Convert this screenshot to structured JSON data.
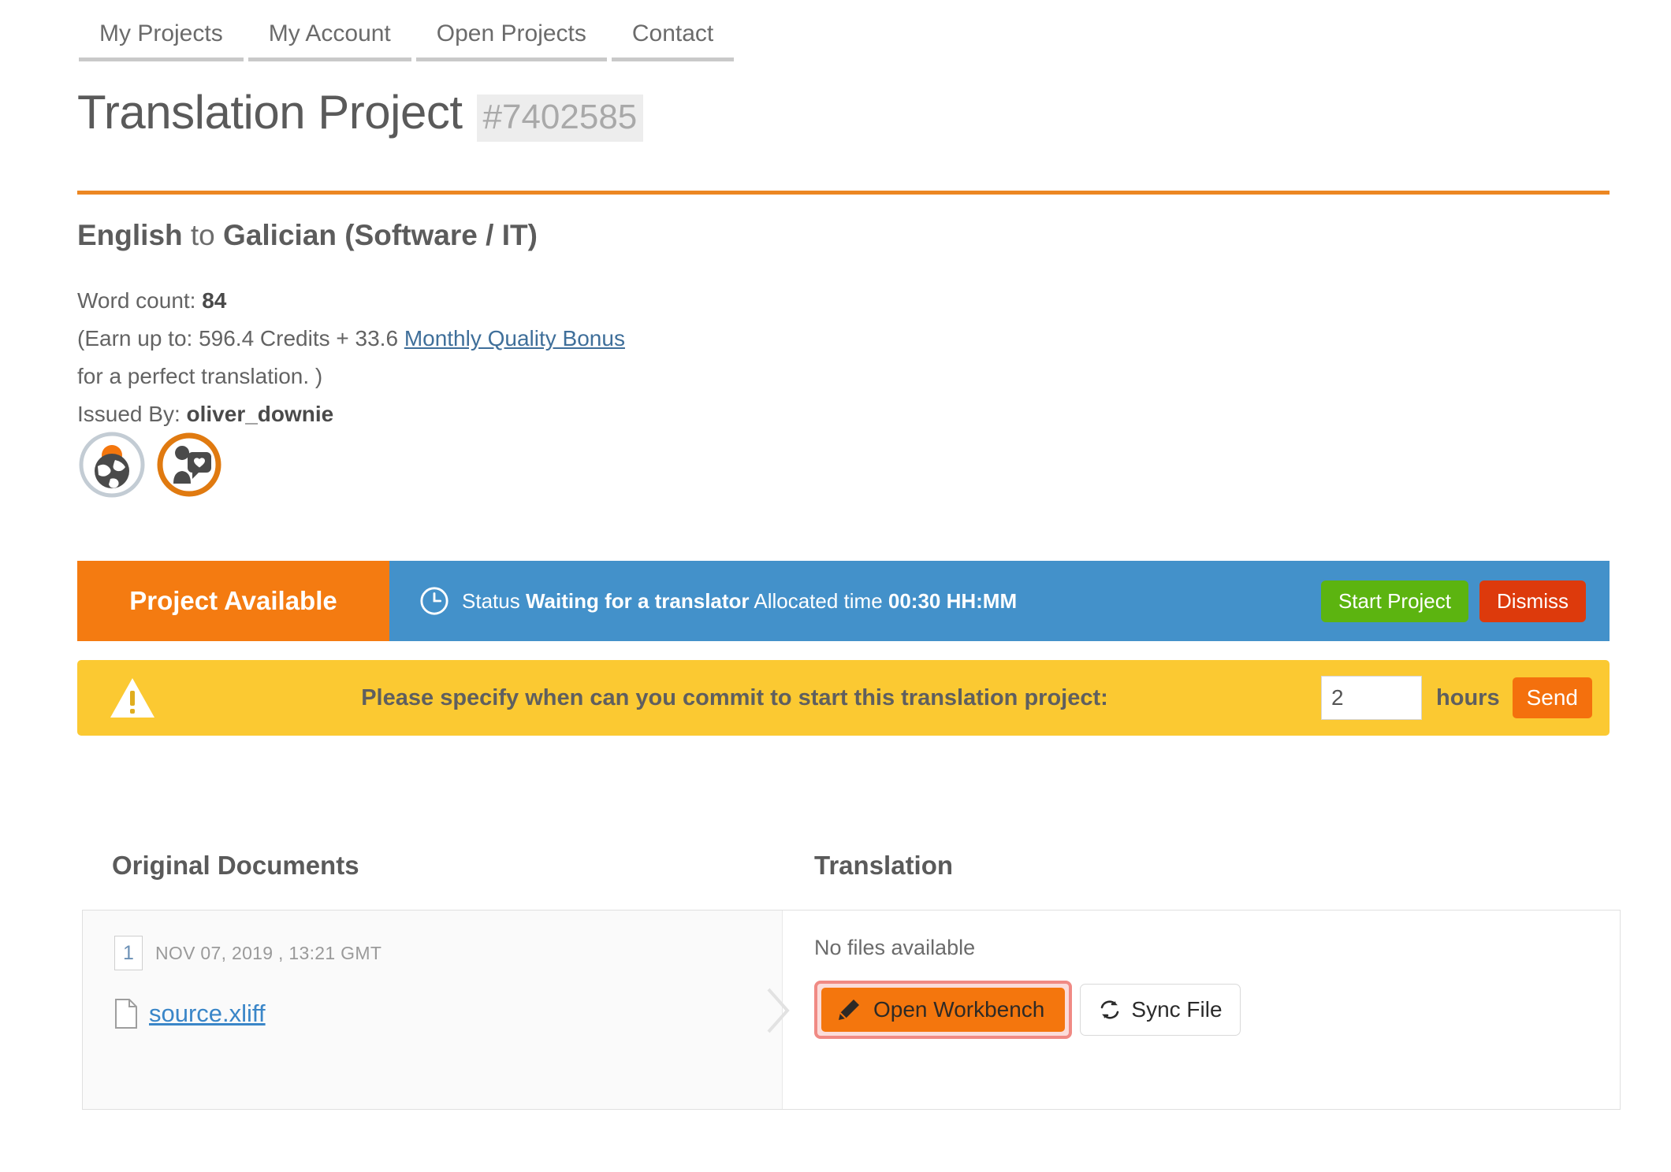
{
  "nav": {
    "items": [
      {
        "label": "My Projects"
      },
      {
        "label": "My Account"
      },
      {
        "label": "Open Projects"
      },
      {
        "label": "Contact"
      }
    ]
  },
  "header": {
    "title": "Translation Project",
    "project_id": "#7402585"
  },
  "project": {
    "source_language": "English",
    "connector": " to ",
    "target_language": "Galician (Software / IT)",
    "word_count_label": "Word count: ",
    "word_count": "84",
    "earn_prefix": "(Earn up to: 596.4 Credits + 33.6 ",
    "earn_link": "Monthly Quality Bonus",
    "earn_suffix": "for a perfect translation. )",
    "issued_by_label": "Issued By: ",
    "issued_by": "oliver_downie",
    "badges": [
      {
        "name": "globe-sunrise-badge"
      },
      {
        "name": "speech-heart-badge"
      }
    ]
  },
  "status": {
    "availability": "Project Available",
    "status_label": "Status ",
    "status_value": "Waiting for a translator",
    "allocated_label": " Allocated time ",
    "allocated_value": "00:30 HH:MM",
    "start_button": "Start Project",
    "dismiss_button": "Dismiss"
  },
  "warning": {
    "message": "Please specify when can you commit to start this translation project:",
    "hours_value": "2",
    "hours_placeholder": "",
    "hours_label": "hours",
    "send_button": "Send"
  },
  "documents": {
    "original_heading": "Original Documents",
    "translation_heading": "Translation",
    "original_file": {
      "number": "1",
      "date": "NOV 07, 2019 , 13:21 GMT",
      "filename": "source.xliff"
    },
    "translation": {
      "empty_text": "No files available",
      "open_workbench_button": "Open Workbench",
      "sync_file_button": "Sync File"
    }
  },
  "colors": {
    "accent_orange": "#ec8722",
    "status_orange": "#f47b11",
    "status_blue": "#4391ca",
    "start_green": "#5cb410",
    "dismiss_red": "#dd3a0c",
    "warning_yellow": "#fbc932",
    "link_blue": "#3a86c8",
    "highlight_pink": "#f08a84"
  }
}
